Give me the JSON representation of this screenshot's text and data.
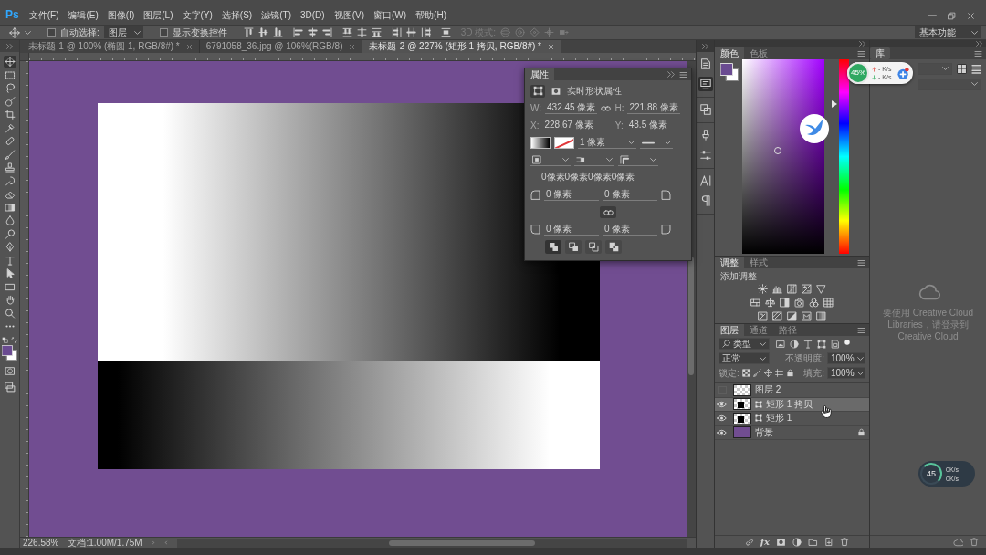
{
  "title_bar": {
    "logo": "Ps",
    "menu": [
      "文件(F)",
      "编辑(E)",
      "图像(I)",
      "图层(L)",
      "文字(Y)",
      "选择(S)",
      "滤镜(T)",
      "3D(D)",
      "视图(V)",
      "窗口(W)",
      "帮助(H)"
    ]
  },
  "options_bar": {
    "auto_select": {
      "label": "自动选择:",
      "checked": false
    },
    "auto_select_target": "图层",
    "transform_controls": {
      "label": "显示变换控件",
      "checked": false
    },
    "mode_3d": {
      "label": "3D 模式:",
      "disabled": true
    },
    "workspace": "基本功能"
  },
  "document_tabs": [
    {
      "title": "未标题-1 @ 100% (椭圆 1, RGB/8#) *",
      "selected": false
    },
    {
      "title": "6791058_36.jpg @ 106%(RGB/8)",
      "selected": false
    },
    {
      "title": "未标题-2 @ 227% (矩形 1 拷贝, RGB/8#) *",
      "selected": true
    }
  ],
  "tools": [
    {
      "selected": true
    },
    {
      "selected": false
    },
    {
      "selected": false
    },
    {
      "selected": false
    },
    {
      "selected": false
    },
    {
      "selected": false
    },
    {
      "selected": false
    },
    {
      "selected": false
    },
    {
      "selected": false
    },
    {
      "selected": false
    },
    {
      "selected": false
    },
    {
      "selected": false
    },
    {
      "selected": false
    },
    {
      "selected": false
    },
    {
      "selected": false
    },
    {
      "selected": false
    },
    {
      "selected": false
    },
    {
      "selected": false
    },
    {
      "selected": false
    },
    {
      "selected": false
    },
    {
      "selected": false
    }
  ],
  "panel_icons": [
    {
      "selected": false
    },
    {
      "selected": true
    },
    {
      "selected": false
    },
    {
      "selected": false
    },
    {
      "selected": false
    },
    {
      "selected": false
    },
    {
      "selected": false
    }
  ],
  "properties_panel": {
    "title": "属性",
    "heading": "实时形状属性",
    "width": {
      "label": "W:",
      "value": "432.45 像素"
    },
    "height": {
      "label": "H:",
      "value": "221.88 像素"
    },
    "x": {
      "label": "X:",
      "value": "228.67 像素"
    },
    "y": {
      "label": "Y:",
      "value": "48.5 像素"
    },
    "stroke_width": "1 像素",
    "corner_radii": "0像素0像素0像素0像素",
    "corners": [
      "0 像素",
      "0 像素",
      "0 像素",
      "0 像素"
    ]
  },
  "color_panel": {
    "tabs": [
      {
        "label": "颜色",
        "selected": true
      },
      {
        "label": "色板",
        "selected": false
      }
    ],
    "brightness": {
      "level": 0.53
    },
    "hue_slider": {
      "level": 0.77
    }
  },
  "adjustments_panel": {
    "tabs": [
      {
        "label": "调整",
        "selected": true
      },
      {
        "label": "样式",
        "selected": false
      }
    ],
    "hint": "添加调整"
  },
  "layers_panel": {
    "tabs": [
      {
        "label": "图层",
        "selected": true
      },
      {
        "label": "通道",
        "selected": false
      },
      {
        "label": "路径",
        "selected": false
      }
    ],
    "filter": "类型",
    "blend_mode": "正常",
    "opacity_label": "不透明度:",
    "opacity": "100%",
    "lock_label": "锁定:",
    "fill_label": "填充:",
    "fill": "100%",
    "layers": [
      {
        "name": "图层 2",
        "kind": "pixel",
        "visible": false,
        "selected": false,
        "locked": false
      },
      {
        "name": "矩形 1 拷贝",
        "kind": "shape",
        "visible": true,
        "selected": true,
        "locked": false
      },
      {
        "name": "矩形 1",
        "kind": "shape",
        "visible": true,
        "selected": false,
        "locked": false
      },
      {
        "name": "背景",
        "kind": "background",
        "visible": true,
        "selected": false,
        "locked": true
      }
    ],
    "effects_button": "fx"
  },
  "libraries_panel": {
    "tab": "库",
    "message": "要使用 Creative Cloud Libraries，请登录到 Creative Cloud"
  },
  "status_bar": {
    "zoom": "226.58%",
    "document_size": "文档:1.00M/1.75M"
  },
  "speed_widget": {
    "percent": "45%",
    "upload": "- K/s",
    "download": "- K/s"
  },
  "speed_widget_docked": {
    "percent": "45",
    "upload": "0K/s",
    "download": "0K/s"
  }
}
